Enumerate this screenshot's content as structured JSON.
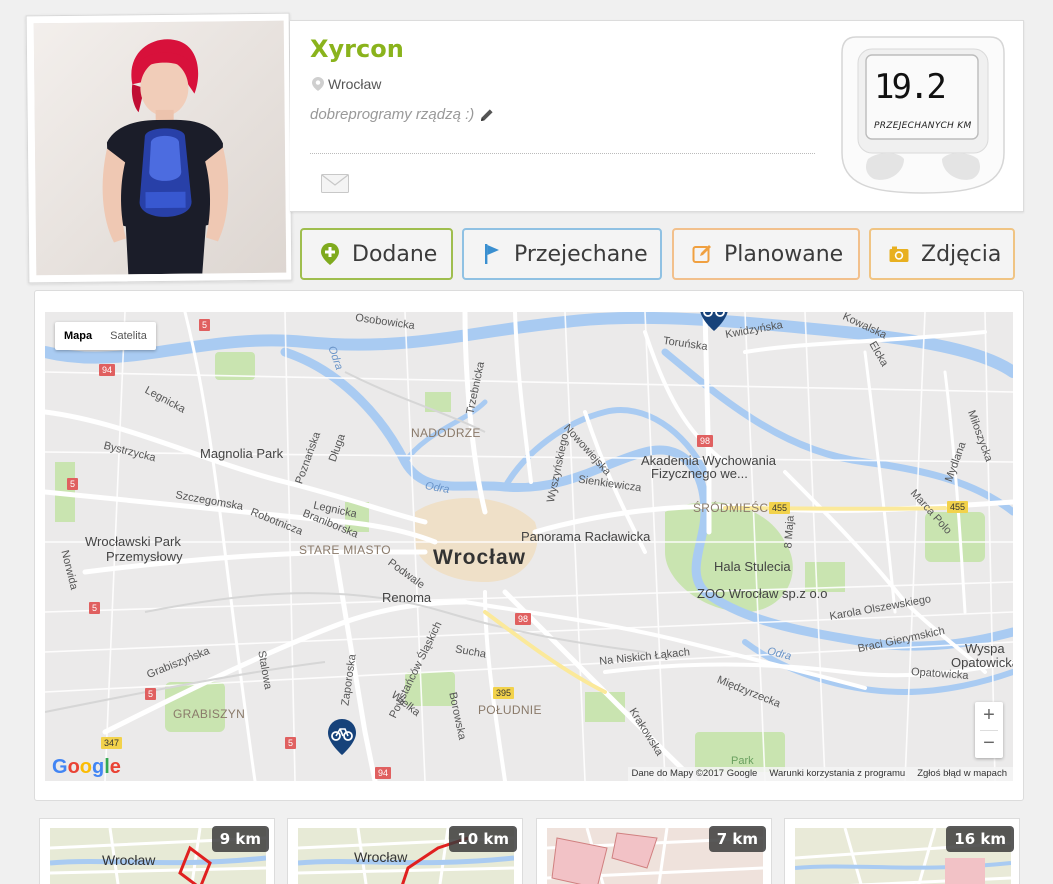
{
  "profile": {
    "username": "Xyrcon",
    "location": "Wrocław",
    "bio": "dobreprogramy rządzą :)",
    "distance_value": "19.2",
    "distance_label": "PRZEJECHANYCH KM",
    "icons": {
      "location": "location-pin-icon",
      "edit": "pencil-icon",
      "message": "envelope-icon"
    }
  },
  "tabs": [
    {
      "label": "Dodane",
      "icon": "plus-pin-icon",
      "color": "#8ab31c"
    },
    {
      "label": "Przejechane",
      "icon": "flag-icon",
      "color": "#3a8fd0"
    },
    {
      "label": "Planowane",
      "icon": "edit-square-icon",
      "color": "#f0a040"
    },
    {
      "label": "Zdjęcia",
      "icon": "camera-icon",
      "color": "#e8b020"
    }
  ],
  "map": {
    "type_buttons": [
      "Mapa",
      "Satelita"
    ],
    "active_type": "Mapa",
    "zoom_in": "+",
    "zoom_out": "−",
    "logo": "Google",
    "attribution": [
      "Dane do Mapy ©2017 Google",
      "Warunki korzystania z programu",
      "Zgłoś błąd w mapach"
    ],
    "city": "Wrocław",
    "districts": [
      "NADODRZE",
      "ŚRÓDMIEŚCIE",
      "STARE MIASTO",
      "POŁUDNIE",
      "GRABISZYN"
    ],
    "places": [
      "Magnolia Park",
      "Akademia Wychowania",
      "Fizycznego we...",
      "Wrocławski Park",
      "Przemysłowy",
      "Panorama Racławicka",
      "Hala Stulecia",
      "ZOO Wrocław sp.z o.o",
      "Renoma",
      "Wyspa",
      "Opatowicka",
      "Park"
    ],
    "streets": [
      "Osobowicka",
      "Kwidzyńska",
      "Toruńska",
      "Kowalska",
      "Legnicka",
      "Bystrzycka",
      "Szczegomska",
      "Robotnicza",
      "Braniborska",
      "Legnicka",
      "Trzebnicka",
      "Poznańska",
      "Długa",
      "Nowowiejska",
      "Wyszyńskiego",
      "Sienkiewicza",
      "Podwale",
      "Sucha",
      "Powstańców Śląskich",
      "Zaporoska",
      "Wielka",
      "Borowska",
      "Grabiszyńska",
      "Stalowa",
      "Na Niskich Łąkach",
      "Międzyrzecka",
      "Karola Olszewskiego",
      "Braci Gierymskich",
      "Opatowicka",
      "Krakowska",
      "Marca Polo",
      "Mydlana",
      "Miłoszycka",
      "Elcka",
      "Norwida",
      "8 Maja",
      "Odra",
      "Odra",
      "Odra"
    ],
    "road_shields": [
      "5",
      "94",
      "5",
      "5",
      "5",
      "98",
      "455",
      "455",
      "98",
      "395",
      "5",
      "347",
      "94",
      "5",
      "98"
    ],
    "pin_icon": "bicycle-marker-icon"
  },
  "routes": [
    {
      "km": "9 km",
      "label": "Wrocław"
    },
    {
      "km": "10 km",
      "label": "Wrocław"
    },
    {
      "km": "7 km",
      "label": ""
    },
    {
      "km": "16 km",
      "label": ""
    }
  ]
}
